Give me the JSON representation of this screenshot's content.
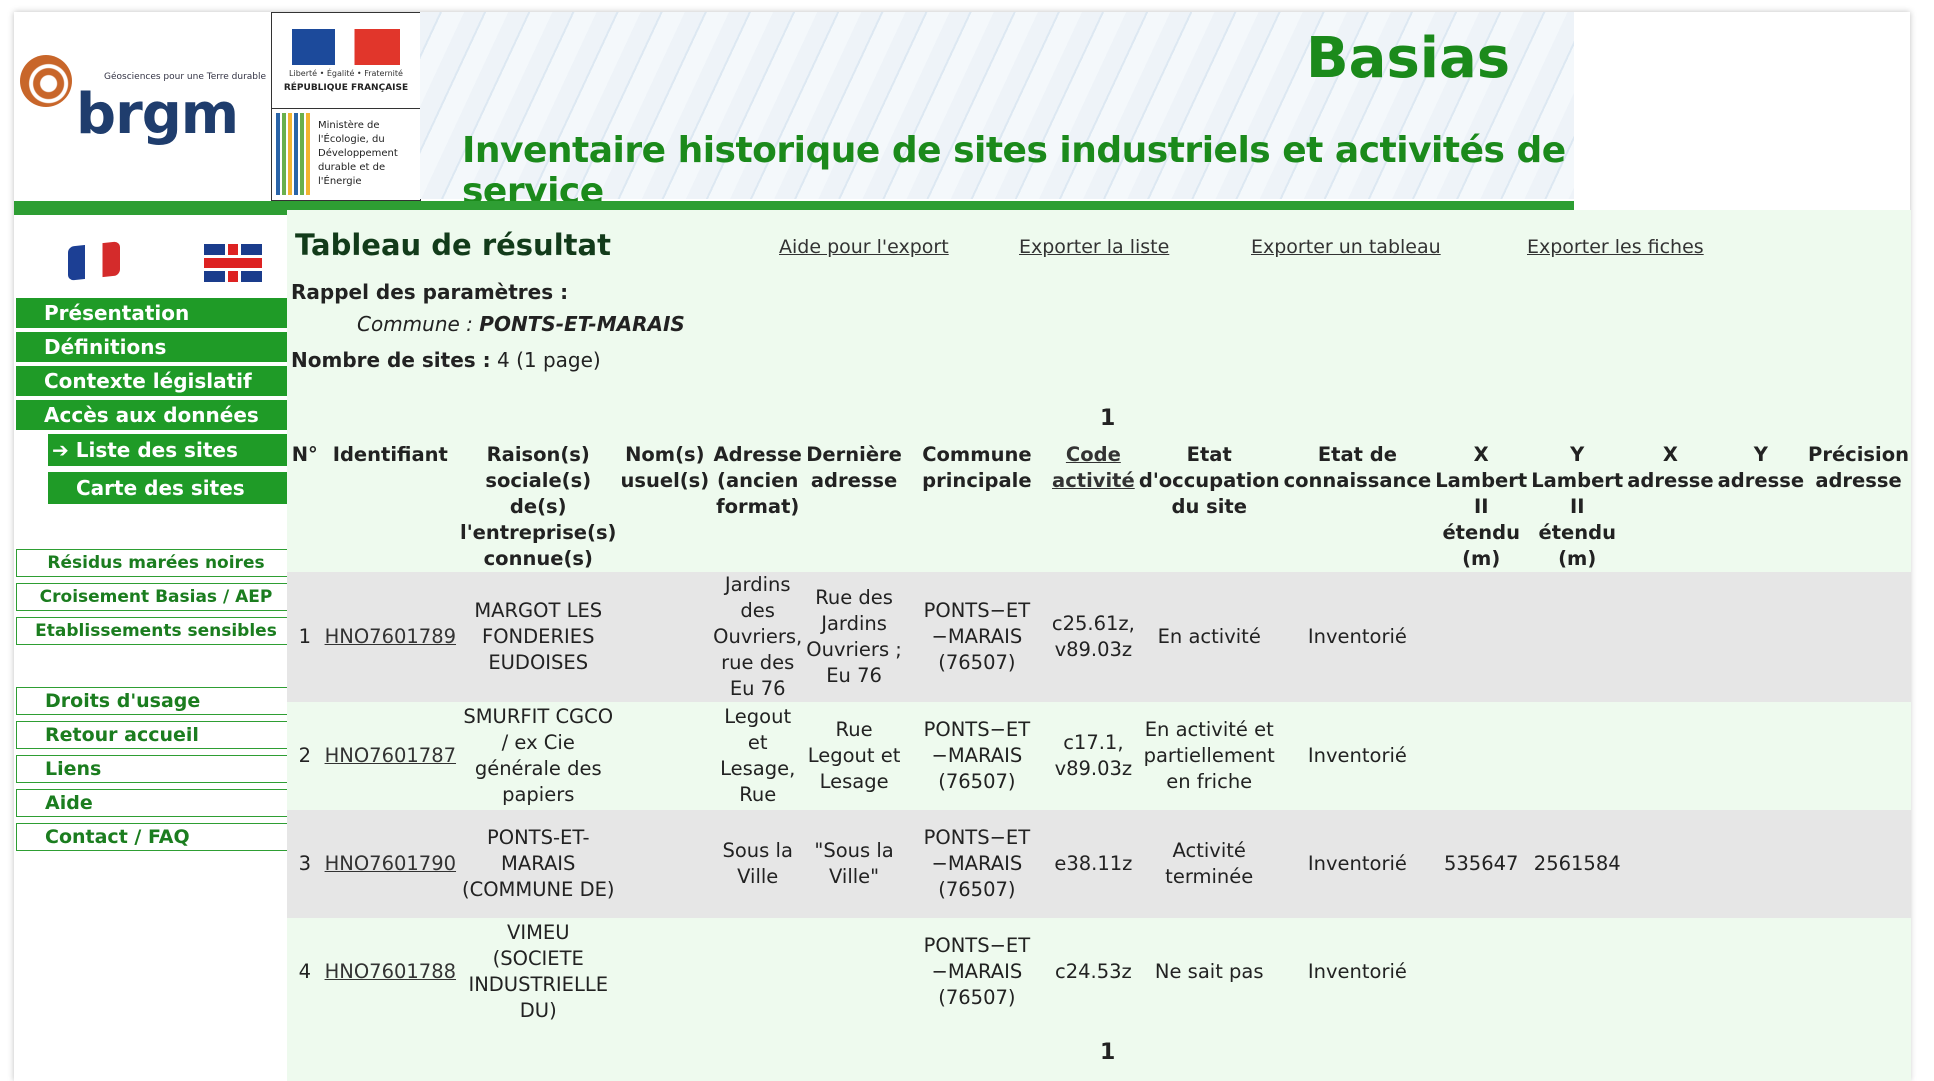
{
  "header": {
    "brgm_tagline": "Géosciences pour une Terre durable",
    "brgm_name": "brgm",
    "gov_motto": "Liberté • Égalité • Fraternité",
    "gov_republic": "RÉPUBLIQUE FRANÇAISE",
    "ministry": "Ministère de l'Écologie, du Développement durable et de l'Énergie",
    "title": "Basias",
    "subtitle": "Inventaire historique de sites industriels et activités de service"
  },
  "sidebar": {
    "lang_fr": "flag-france-icon",
    "lang_en": "flag-uk-icon",
    "menu": [
      "Présentation",
      "Définitions",
      "Contexte législatif",
      "Accès aux données"
    ],
    "submenu": [
      "➔ Liste des sites",
      "Carte des sites"
    ],
    "extra": [
      "Résidus marées noires",
      "Croisement Basias / AEP",
      "Etablissements sensibles"
    ],
    "footer_links": [
      "Droits d'usage",
      "Retour accueil",
      "Liens",
      "Aide",
      "Contact  /  FAQ"
    ]
  },
  "main": {
    "title": "Tableau de résultat",
    "exports": [
      "Aide pour l'export",
      "Exporter la liste",
      "Exporter un tableau",
      "Exporter les fiches"
    ],
    "params_label": "Rappel des paramètres :",
    "commune_label": "Commune : ",
    "commune_value": "PONTS-ET-MARAIS",
    "nb_sites_label": "Nombre de sites :",
    "nb_sites_value": " 4  (1 page)",
    "page_top": "1",
    "page_bottom": "1"
  },
  "table": {
    "headers": {
      "num": "N°",
      "id": "Identifiant",
      "raison": "Raison(s) sociale(s) de(s) l'entreprise(s) connue(s)",
      "nom": "Nom(s) usuel(s)",
      "adresse_ancien": "Adresse (ancien format)",
      "derniere": "Dernière adresse",
      "commune": "Commune principale",
      "code": "Code activité",
      "etat_occ": "Etat d'occupation du site",
      "etat_conn": "Etat de connaissance",
      "x_lambert": "X Lambert II étendu (m)",
      "y_lambert": "Y Lambert II étendu (m)",
      "x_adresse": "X adresse",
      "y_adresse": "Y adresse",
      "precision": "Précision adresse"
    },
    "rows": [
      {
        "num": "1",
        "id": "HNO7601789",
        "raison": "MARGOT LES FONDERIES EUDOISES",
        "nom": "",
        "adresse_ancien": "Jardins des Ouvriers, rue des Eu 76",
        "derniere": "Rue des Jardins Ouvriers ; Eu 76",
        "commune": "PONTS−ET −MARAIS (76507)",
        "code": "c25.61z, v89.03z",
        "etat_occ": "En activité",
        "etat_conn": "Inventorié",
        "x_lambert": "",
        "y_lambert": "",
        "x_adresse": "",
        "y_adresse": "",
        "precision": ""
      },
      {
        "num": "2",
        "id": "HNO7601787",
        "raison": "SMURFIT CGCO / ex Cie générale des papiers",
        "nom": "",
        "adresse_ancien": "Legout et Lesage, Rue",
        "derniere": "Rue Legout et Lesage",
        "commune": "PONTS−ET −MARAIS (76507)",
        "code": "c17.1, v89.03z",
        "etat_occ": "En activité et partiellement en friche",
        "etat_conn": "Inventorié",
        "x_lambert": "",
        "y_lambert": "",
        "x_adresse": "",
        "y_adresse": "",
        "precision": ""
      },
      {
        "num": "3",
        "id": "HNO7601790",
        "raison": "PONTS-ET-MARAIS (COMMUNE DE)",
        "nom": "",
        "adresse_ancien": "Sous la Ville",
        "derniere": "\"Sous la Ville\"",
        "commune": "PONTS−ET −MARAIS (76507)",
        "code": "e38.11z",
        "etat_occ": "Activité terminée",
        "etat_conn": "Inventorié",
        "x_lambert": "535647",
        "y_lambert": "2561584",
        "x_adresse": "",
        "y_adresse": "",
        "precision": ""
      },
      {
        "num": "4",
        "id": "HNO7601788",
        "raison": "VIMEU (SOCIETE INDUSTRIELLE DU)",
        "nom": "",
        "adresse_ancien": "",
        "derniere": "",
        "commune": "PONTS−ET −MARAIS (76507)",
        "code": "c24.53z",
        "etat_occ": "Ne sait pas",
        "etat_conn": "Inventorié",
        "x_lambert": "",
        "y_lambert": "",
        "x_adresse": "",
        "y_adresse": "",
        "precision": ""
      }
    ]
  }
}
